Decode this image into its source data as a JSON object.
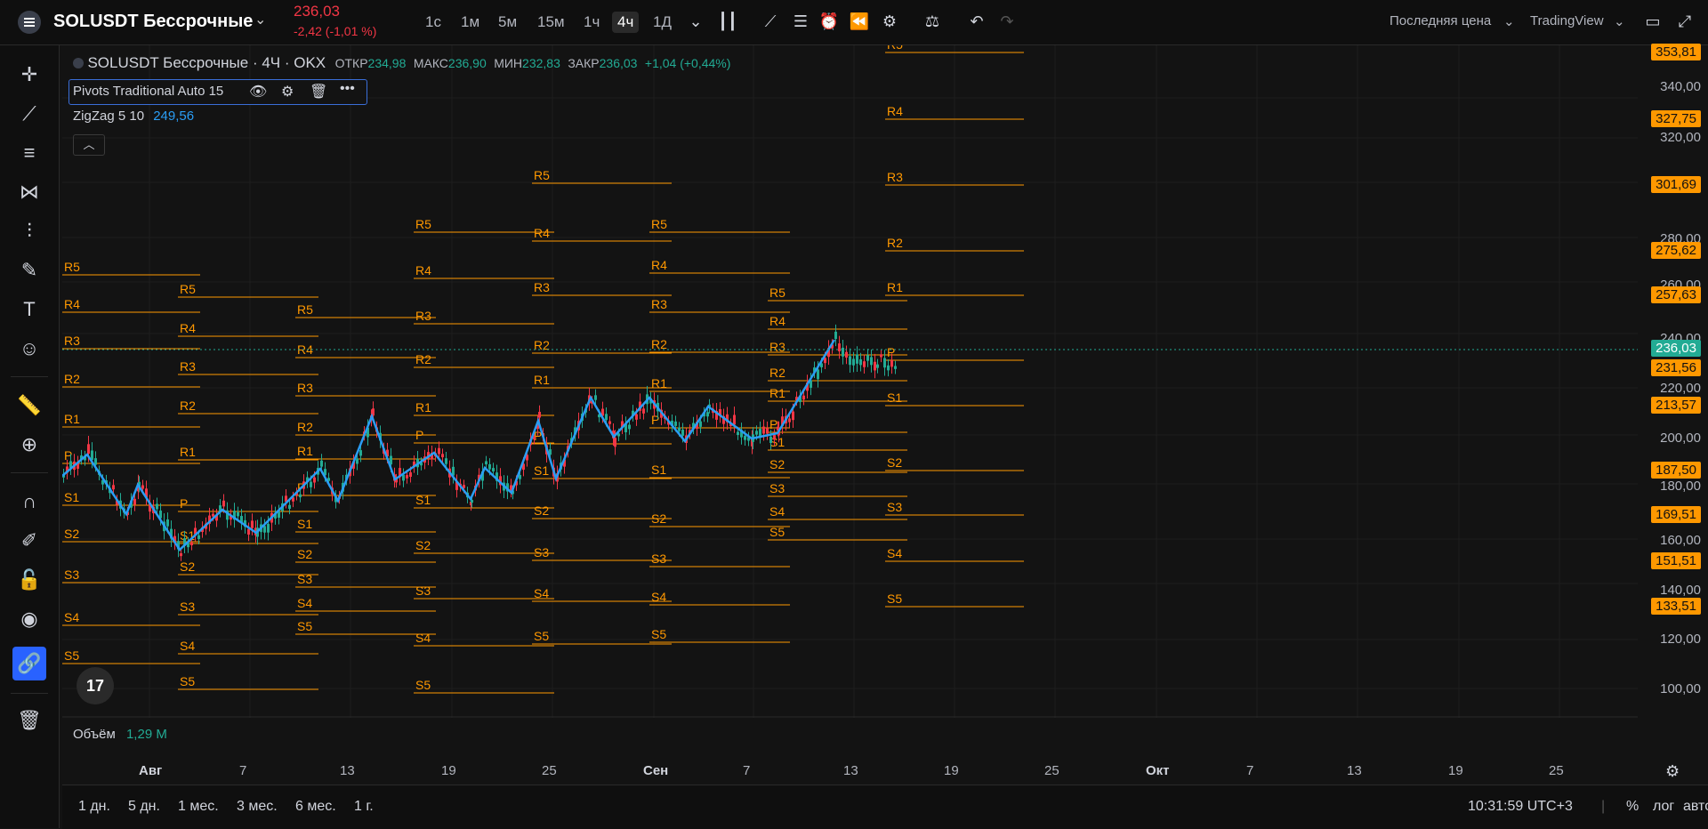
{
  "symbol": {
    "name": "SOLUSDT Бессрочные",
    "price": "236,03",
    "change": "-2,42 (-1,01 %)"
  },
  "timeframes": [
    "1с",
    "1м",
    "5м",
    "15м",
    "1ч",
    "4ч",
    "1Д"
  ],
  "active_timeframe": "4ч",
  "top_right": {
    "price_source": "Последняя цена",
    "broker": "TradingView"
  },
  "legend": {
    "title": "SOLUSDT Бессрочные · 4Ч · OKX",
    "open_label": "ОТКР",
    "open": "234,98",
    "high_label": "МАКС",
    "high": "236,90",
    "low_label": "МИН",
    "low": "232,83",
    "close_label": "ЗАКР",
    "close": "236,03",
    "change": "+1,04 (+0,44%)",
    "pivots": "Pivots Traditional Auto 15",
    "zigzag_name": "ZigZag 5 10",
    "zigzag_value": "249,56"
  },
  "volume": {
    "label": "Объём",
    "value": "1,29 M"
  },
  "price_axis": {
    "ticks": [
      "340,00",
      "320,00",
      "280,00",
      "260,00",
      "240,00",
      "220,00",
      "200,00",
      "180,00",
      "160,00",
      "140,00",
      "120,00",
      "100,00"
    ],
    "badges": [
      "353,81",
      "327,75",
      "301,69",
      "275,62",
      "257,63",
      "231,56",
      "213,57",
      "187,50",
      "169,51",
      "151,51",
      "133,51"
    ],
    "current": "236,03"
  },
  "time_axis": [
    "Авг",
    "7",
    "13",
    "19",
    "25",
    "Сен",
    "7",
    "13",
    "19",
    "25",
    "Окт",
    "7",
    "13",
    "19",
    "25"
  ],
  "bottom": {
    "ranges": [
      "1 дн.",
      "5 дн.",
      "1 мес.",
      "3 мес.",
      "6 мес.",
      "1 г."
    ],
    "clock": "10:31:59 UTC+3",
    "percent": "%",
    "log": "лог",
    "auto": "авто"
  },
  "colors": {
    "pivot": "#ff9800",
    "zigzag": "#2a9df4",
    "up": "#22ab94",
    "down": "#f23645",
    "background": "#131313"
  },
  "pivot_labels": [
    "R5",
    "R4",
    "R3",
    "R2",
    "R1",
    "P",
    "S1",
    "S2",
    "S3",
    "S4",
    "S5"
  ]
}
